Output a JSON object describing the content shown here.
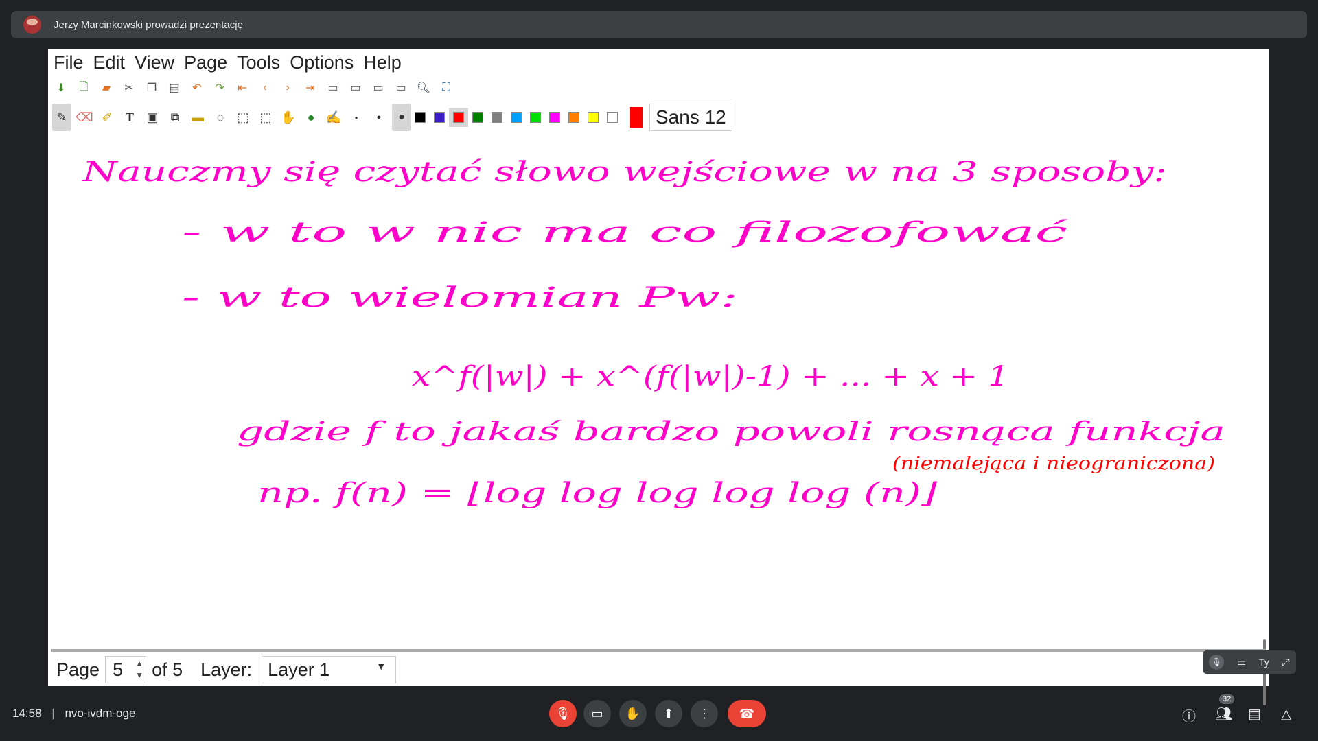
{
  "meet": {
    "presenter_banner": "Jerzy Marcinkowski prowadzi prezentację",
    "time": "14:58",
    "separator": "|",
    "meeting_code": "nvo-ivdm-oge",
    "participants_count": "32",
    "self_view_label": "Ty"
  },
  "app": {
    "menu": [
      "File",
      "Edit",
      "View",
      "Page",
      "Tools",
      "Options",
      "Help"
    ],
    "font": "Sans 12",
    "colors": [
      "#000000",
      "#3c1cc4",
      "#ff0000",
      "#008000",
      "#808080",
      "#00a0ff",
      "#00e000",
      "#ff00ff",
      "#ff8000",
      "#ffff00",
      "#ffffff"
    ],
    "current_color": "#ff0000",
    "ink_color": "#ff00c8"
  },
  "status": {
    "page_label": "Page",
    "page_value": "5",
    "of_label": "of 5",
    "layer_label": "Layer:",
    "layer_value": "Layer 1"
  },
  "notes": {
    "line1": "Nauczmy się czytać słowo wejściowe w na 3 sposoby:",
    "line2": "- w to w nic ma co filozofować",
    "line3": "- w to wielomian Pw:",
    "formula": "x^f(|w|) + x^(f(|w|)-1) + ... + x + 1",
    "line4": "gdzie f to jakaś bardzo powoli rosnąca funkcja",
    "line4_note": "(niemalejąca i nieograniczona)",
    "line5": "np. f(n) = ⌊log log log log log (n)⌋"
  }
}
